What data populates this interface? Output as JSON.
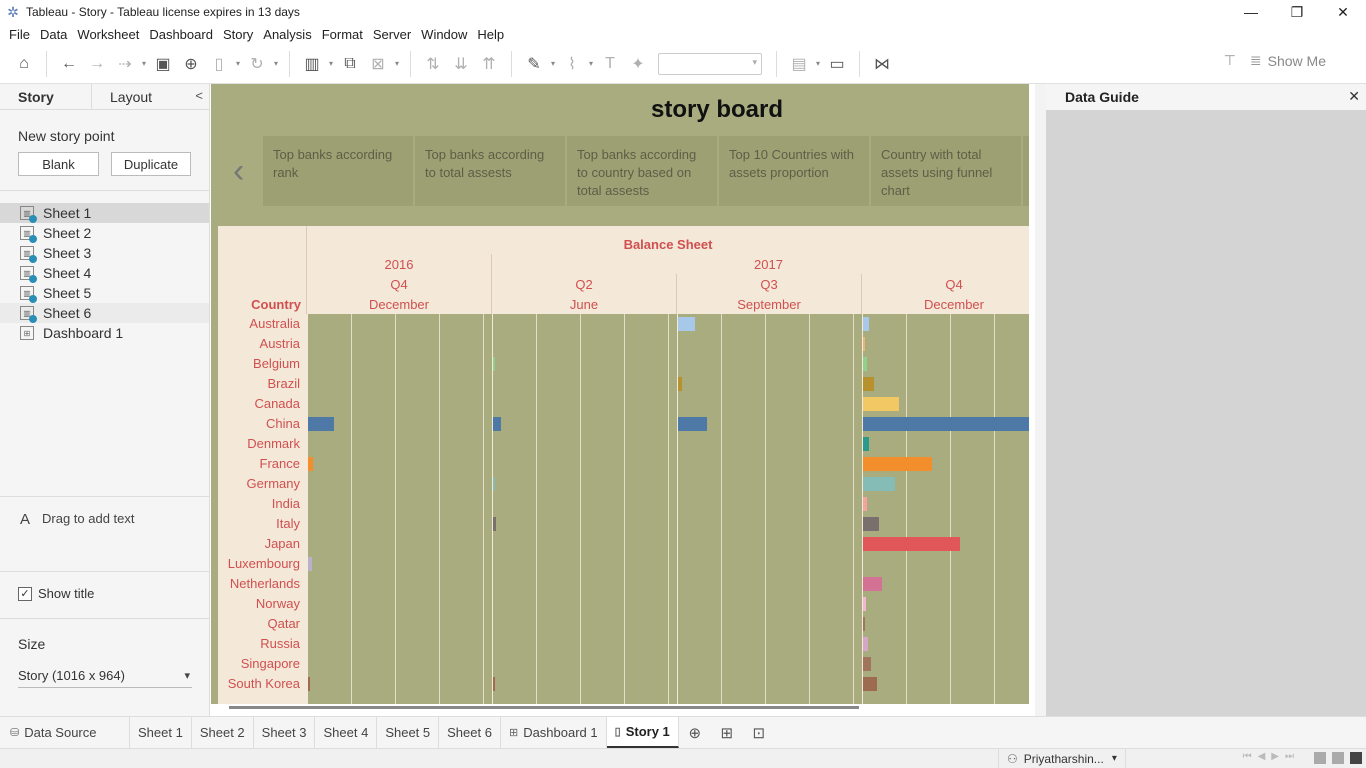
{
  "window": {
    "title": "Tableau - Story - Tableau license expires in 13 days",
    "controls": [
      "—",
      "❐",
      "✕"
    ]
  },
  "menu": [
    "File",
    "Data",
    "Worksheet",
    "Dashboard",
    "Story",
    "Analysis",
    "Format",
    "Server",
    "Window",
    "Help"
  ],
  "toolbar": {
    "show_me_label": "Show Me",
    "icons": [
      "home-icon",
      "undo-icon",
      "redo-icon",
      "replay-icon",
      "save-icon",
      "new-datasource-icon",
      "pause-icon",
      "refresh-icon",
      "new-worksheet-icon",
      "duplicate-icon",
      "clear-icon",
      "swap-icon",
      "sort-asc-icon",
      "sort-desc-icon",
      "highlight-icon",
      "group-icon",
      "labels-icon",
      "pin-icon",
      "chart-type-icon",
      "presentation-icon",
      "share-icon"
    ]
  },
  "left_panel": {
    "tabs": [
      "Story",
      "Layout"
    ],
    "new_story_point": "New story point",
    "blank_button": "Blank",
    "duplicate_button": "Duplicate",
    "sheets": [
      "Sheet 1",
      "Sheet 2",
      "Sheet 3",
      "Sheet 4",
      "Sheet 5",
      "Sheet 6",
      "Dashboard 1"
    ],
    "drag_text_icon": "A",
    "drag_text": "Drag to add text",
    "show_title_checked": true,
    "show_title": "Show title",
    "size_heading": "Size",
    "size_value": "Story (1016 x 964)"
  },
  "story": {
    "title": "story board",
    "points": [
      "Top banks according rank",
      "Top banks according to total assests",
      "Top banks according to country based on total assests",
      "Top 10 Countries with assets proportion",
      "Country with total assets using funnel chart"
    ]
  },
  "right_panel": {
    "title": "Data Guide"
  },
  "bottom_tabs": {
    "data_source": "Data Source",
    "sheets": [
      "Sheet 1",
      "Sheet 2",
      "Sheet 3",
      "Sheet 4",
      "Sheet 5",
      "Sheet 6",
      "Dashboard 1",
      "Story 1"
    ],
    "active": "Story 1"
  },
  "status": {
    "user": "Priyatharshin..."
  },
  "chart_data": {
    "type": "bar",
    "title": "Balance Sheet",
    "row_header": "Country",
    "column_headers": [
      {
        "year": "2016",
        "quarter": "Q4",
        "month": "December"
      },
      {
        "year": "2017",
        "quarter": "Q2",
        "month": "June"
      },
      {
        "year": "2017",
        "quarter": "Q3",
        "month": "September"
      },
      {
        "year": "2017",
        "quarter": "Q4",
        "month": "December"
      }
    ],
    "categories": [
      "Australia",
      "Austria",
      "Belgium",
      "Brazil",
      "Canada",
      "China",
      "Denmark",
      "France",
      "Germany",
      "India",
      "Italy",
      "Japan",
      "Luxembourg",
      "Netherlands",
      "Norway",
      "Qatar",
      "Russia",
      "Singapore",
      "South Korea"
    ],
    "colors": [
      "#a7c8e8",
      "#f0b27a",
      "#8fd18a",
      "#b8912f",
      "#f2c864",
      "#4e79a7",
      "#2a9a8e",
      "#f28e2b",
      "#86bcb6",
      "#f4a3a0",
      "#79706e",
      "#e15759",
      "#b7b1c9",
      "#d37295",
      "#f2b7d0",
      "#9d7660",
      "#d4a6c8",
      "#a0755c",
      "#9c6b50"
    ],
    "series": [
      {
        "name": "December",
        "values": [
          0,
          0,
          0,
          0,
          0,
          0.58,
          0,
          0.12,
          0,
          0,
          0,
          0,
          0.08,
          0,
          0,
          0,
          0,
          0,
          0.02
        ]
      },
      {
        "name": "June",
        "values": [
          0,
          0,
          0.02,
          0,
          0,
          0.18,
          0,
          0,
          0.02,
          0,
          0.06,
          0,
          0,
          0,
          0,
          0,
          0,
          0,
          0.04
        ]
      },
      {
        "name": "September",
        "values": [
          0.38,
          0,
          0,
          0.1,
          0,
          0.66,
          0,
          0,
          0,
          0,
          0,
          0,
          0,
          0,
          0,
          0,
          0,
          0,
          0
        ]
      },
      {
        "name": "December",
        "values": [
          0.14,
          0.04,
          0.08,
          0.24,
          0.82,
          3.8,
          0.14,
          1.56,
          0.72,
          0.1,
          0.36,
          2.2,
          0,
          0.44,
          0.06,
          0.02,
          0.12,
          0.18,
          0.32
        ]
      }
    ]
  }
}
